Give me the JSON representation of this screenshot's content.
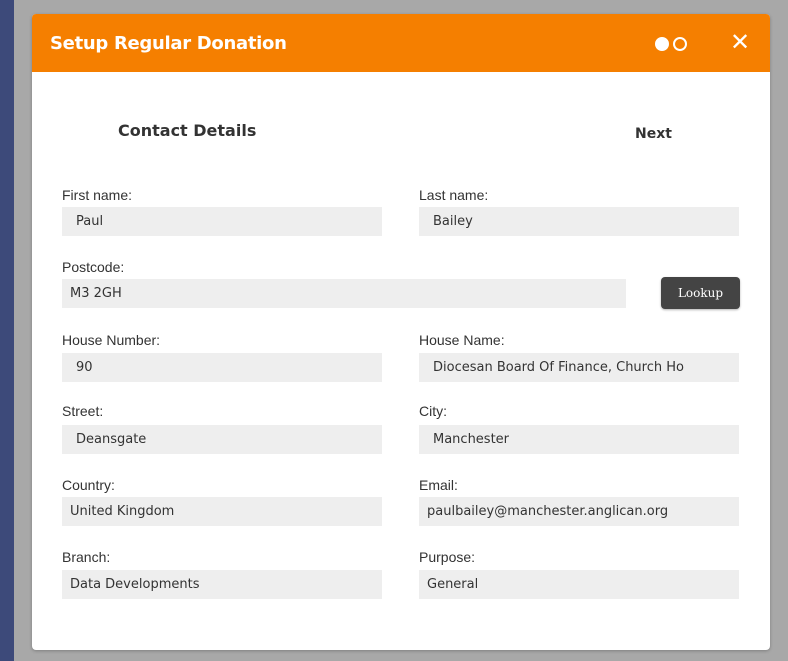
{
  "modal": {
    "title": "Setup Regular Donation",
    "step_dots": [
      {
        "state": "filled"
      },
      {
        "state": "empty"
      }
    ],
    "close_label": "✕"
  },
  "section": {
    "title": "Contact Details",
    "next_label": "Next"
  },
  "fields": {
    "first_name": {
      "label": "First name:",
      "value": "Paul"
    },
    "last_name": {
      "label": "Last name:",
      "value": "Bailey"
    },
    "postcode": {
      "label": "Postcode:",
      "value": "M3 2GH"
    },
    "house_number": {
      "label": "House Number:",
      "value": "90"
    },
    "house_name": {
      "label": "House Name:",
      "value": "Diocesan Board Of Finance,  Church Ho"
    },
    "street": {
      "label": "Street:",
      "value": "Deansgate"
    },
    "city": {
      "label": "City:",
      "value": "Manchester"
    },
    "country": {
      "label": "Country:",
      "value": "United Kingdom"
    },
    "email": {
      "label": "Email:",
      "value": "paulbailey@manchester.anglican.org"
    },
    "branch": {
      "label": "Branch:",
      "value": "Data Developments"
    },
    "purpose": {
      "label": "Purpose:",
      "value": "General"
    }
  },
  "lookup_button": "Lookup",
  "colors": {
    "header": "#f57f00",
    "backdrop": "#a8a8a8",
    "page": "#3d4a7a",
    "input_bg": "#eeeeee",
    "lookup_bg": "#444444"
  }
}
